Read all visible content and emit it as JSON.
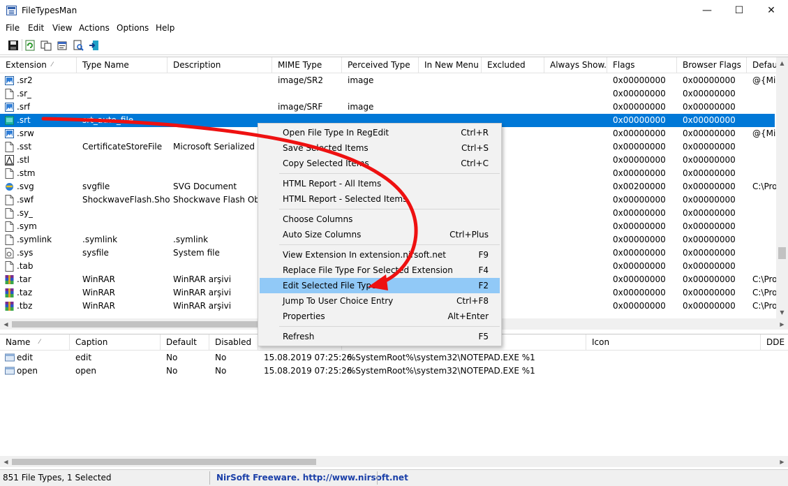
{
  "window": {
    "title": "FileTypesMan",
    "minimize": "—",
    "maximize": "☐",
    "close": "✕"
  },
  "menu": [
    "File",
    "Edit",
    "View",
    "Actions",
    "Options",
    "Help"
  ],
  "toolbar": {
    "icons": [
      "save-icon",
      "refresh-icon",
      "copy-icon",
      "properties-icon",
      "find-icon",
      "exit-icon"
    ]
  },
  "top_list": {
    "columns": [
      "Extension",
      "Type Name",
      "Description",
      "MIME Type",
      "Perceived Type",
      "In New Menu",
      "Excluded",
      "Always Show...",
      "Flags",
      "Browser Flags",
      "Defau"
    ],
    "sort_indicator": "⁄",
    "rows": [
      {
        "icon": "image",
        "ext": ".sr2",
        "type": "",
        "desc": "",
        "mime": "image/SR2",
        "perceived": "image",
        "flags": "0x00000000",
        "browser": "0x00000000",
        "default": "@{Mic"
      },
      {
        "icon": "blank",
        "ext": ".sr_",
        "type": "",
        "desc": "",
        "mime": "",
        "perceived": "",
        "flags": "0x00000000",
        "browser": "0x00000000",
        "default": ""
      },
      {
        "icon": "image",
        "ext": ".srf",
        "type": "",
        "desc": "",
        "mime": "image/SRF",
        "perceived": "image",
        "flags": "0x00000000",
        "browser": "0x00000000",
        "default": ""
      },
      {
        "icon": "srt",
        "ext": ".srt",
        "type": "srt_auto_file",
        "desc": "",
        "mime": "",
        "perceived": "",
        "flags": "0x00000000",
        "browser": "0x00000000",
        "default": "",
        "selected": true
      },
      {
        "icon": "image",
        "ext": ".srw",
        "type": "",
        "desc": "",
        "mime": "",
        "perceived": "",
        "flags": "0x00000000",
        "browser": "0x00000000",
        "default": "@{Mic"
      },
      {
        "icon": "blank",
        "ext": ".sst",
        "type": "CertificateStoreFile",
        "desc": "Microsoft Serialized Ce",
        "mime": "",
        "perceived": "",
        "flags": "0x00000000",
        "browser": "0x00000000",
        "default": ""
      },
      {
        "icon": "stl",
        "ext": ".stl",
        "type": "",
        "desc": "",
        "mime": "",
        "perceived": "",
        "flags": "0x00000000",
        "browser": "0x00000000",
        "default": ""
      },
      {
        "icon": "blank",
        "ext": ".stm",
        "type": "",
        "desc": "",
        "mime": "",
        "perceived": "",
        "flags": "0x00000000",
        "browser": "0x00000000",
        "default": ""
      },
      {
        "icon": "svg",
        "ext": ".svg",
        "type": "svgfile",
        "desc": "SVG Document",
        "mime": "",
        "perceived": "",
        "flags": "0x00200000",
        "browser": "0x00000000",
        "default": "C:\\Pro"
      },
      {
        "icon": "blank",
        "ext": ".swf",
        "type": "ShockwaveFlash.Sho...",
        "desc": "Shockwave Flash Objec",
        "mime": "",
        "perceived": "",
        "flags": "0x00000000",
        "browser": "0x00000000",
        "default": ""
      },
      {
        "icon": "blank",
        "ext": ".sy_",
        "type": "",
        "desc": "",
        "mime": "",
        "perceived": "",
        "flags": "0x00000000",
        "browser": "0x00000000",
        "default": ""
      },
      {
        "icon": "blank",
        "ext": ".sym",
        "type": "",
        "desc": "",
        "mime": "",
        "perceived": "",
        "flags": "0x00000000",
        "browser": "0x00000000",
        "default": ""
      },
      {
        "icon": "blank",
        "ext": ".symlink",
        "type": ".symlink",
        "desc": ".symlink",
        "mime": "",
        "perceived": "",
        "flags": "0x00000000",
        "browser": "0x00000000",
        "default": ""
      },
      {
        "icon": "sys",
        "ext": ".sys",
        "type": "sysfile",
        "desc": "System file",
        "mime": "",
        "perceived": "",
        "flags": "0x00000000",
        "browser": "0x00000000",
        "default": ""
      },
      {
        "icon": "blank",
        "ext": ".tab",
        "type": "",
        "desc": "",
        "mime": "",
        "perceived": "",
        "flags": "0x00000000",
        "browser": "0x00000000",
        "default": ""
      },
      {
        "icon": "rar",
        "ext": ".tar",
        "type": "WinRAR",
        "desc": "WinRAR arşivi",
        "mime": "",
        "perceived": "",
        "flags": "0x00000000",
        "browser": "0x00000000",
        "default": "C:\\Pro"
      },
      {
        "icon": "rar",
        "ext": ".taz",
        "type": "WinRAR",
        "desc": "WinRAR arşivi",
        "mime": "",
        "perceived": "",
        "flags": "0x00000000",
        "browser": "0x00000000",
        "default": "C:\\Pro"
      },
      {
        "icon": "rar",
        "ext": ".tbz",
        "type": "WinRAR",
        "desc": "WinRAR arşivi",
        "mime": "",
        "perceived": "",
        "flags": "0x00000000",
        "browser": "0x00000000",
        "default": "C:\\Pro"
      }
    ]
  },
  "bottom_list": {
    "columns": [
      "Name",
      "Caption",
      "Default",
      "Disabled",
      "",
      "",
      "Icon",
      "DDE M"
    ],
    "sort_indicator": "⁄",
    "rows": [
      {
        "name": "edit",
        "caption": "edit",
        "default": "No",
        "disabled": "No",
        "modified": "15.08.2019 07:25:26",
        "command": "%SystemRoot%\\system32\\NOTEPAD.EXE %1"
      },
      {
        "name": "open",
        "caption": "open",
        "default": "No",
        "disabled": "No",
        "modified": "15.08.2019 07:25:26",
        "command": "%SystemRoot%\\system32\\NOTEPAD.EXE %1"
      }
    ]
  },
  "context_menu": {
    "groups": [
      [
        {
          "label": "Open File Type In RegEdit",
          "shortcut": "Ctrl+R"
        },
        {
          "label": "Save Selected Items",
          "shortcut": "Ctrl+S"
        },
        {
          "label": "Copy Selected Items",
          "shortcut": "Ctrl+C"
        }
      ],
      [
        {
          "label": "HTML Report - All Items",
          "shortcut": ""
        },
        {
          "label": "HTML Report - Selected Items",
          "shortcut": ""
        }
      ],
      [
        {
          "label": "Choose Columns",
          "shortcut": ""
        },
        {
          "label": "Auto Size Columns",
          "shortcut": "Ctrl+Plus"
        }
      ],
      [
        {
          "label": "View Extension In extension.nirsoft.net",
          "shortcut": "F9"
        },
        {
          "label": "Replace File Type For Selected Extension",
          "shortcut": "F4"
        },
        {
          "label": "Edit Selected File Type",
          "shortcut": "F2",
          "active": true
        },
        {
          "label": "Jump To User Choice Entry",
          "shortcut": "Ctrl+F8"
        },
        {
          "label": "Properties",
          "shortcut": "Alt+Enter"
        }
      ],
      [
        {
          "label": "Refresh",
          "shortcut": "F5"
        }
      ]
    ]
  },
  "status": {
    "count": "851 File Types, 1 Selected",
    "credit": "NirSoft Freeware.  http://www.nirsoft.net",
    "credit_color": "#1a3fa8"
  },
  "colors": {
    "selection": "#0078d7",
    "menu_highlight": "#91c9f7",
    "annotation_arrow": "#ee1111"
  }
}
